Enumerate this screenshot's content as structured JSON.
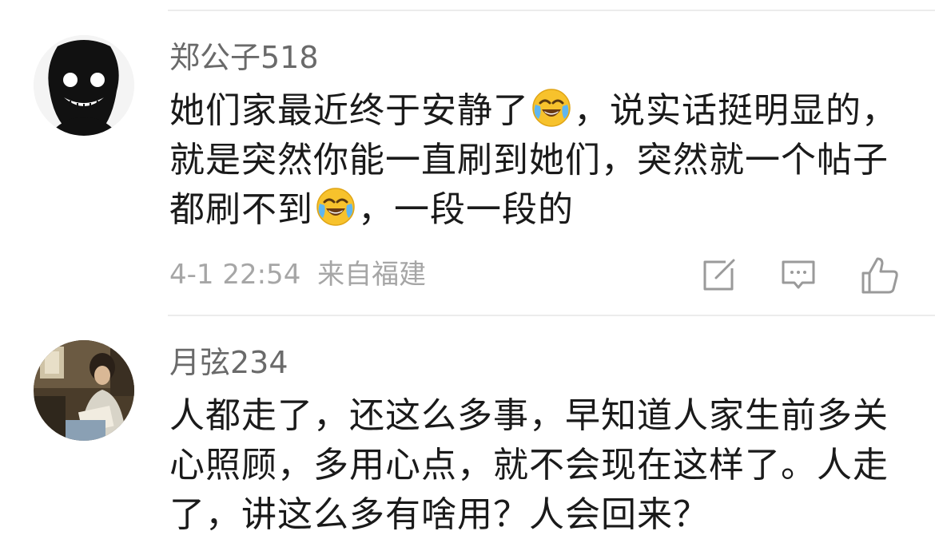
{
  "comments": [
    {
      "username": "郑公子518",
      "text_segments": [
        "她们家最近终于安静了",
        "，说实话挺明显的，就是突然你能一直刷到她们，突然就一个帖子都刷不到",
        "，一段一段的"
      ],
      "emoji": "face-with-tears-of-joy-icon",
      "timestamp": "4-1 22:54",
      "location": "来自福建"
    },
    {
      "username": "月弦234",
      "text": "人都走了，还这么多事，早知道人家生前多关心照顾，多用心点，就不会现在这样了。人走了，讲这么多有啥用？人会回来？"
    }
  ],
  "colors": {
    "username": "#6a6a6a",
    "body_text": "#1a1a1a",
    "meta_text": "#a6a6a6",
    "icon": "#9a9a9a",
    "divider": "#ececec"
  }
}
